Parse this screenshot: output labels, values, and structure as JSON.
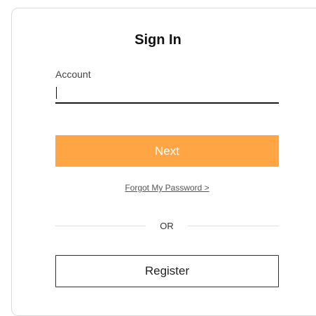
{
  "signin": {
    "title": "Sign In",
    "account_label": "Account",
    "account_value": "",
    "next_label": "Next",
    "forgot_label": "Forgot My Password >",
    "divider_label": "OR",
    "register_label": "Register",
    "colors": {
      "primary": "#ffa544",
      "border": "#dcdcdc"
    }
  }
}
